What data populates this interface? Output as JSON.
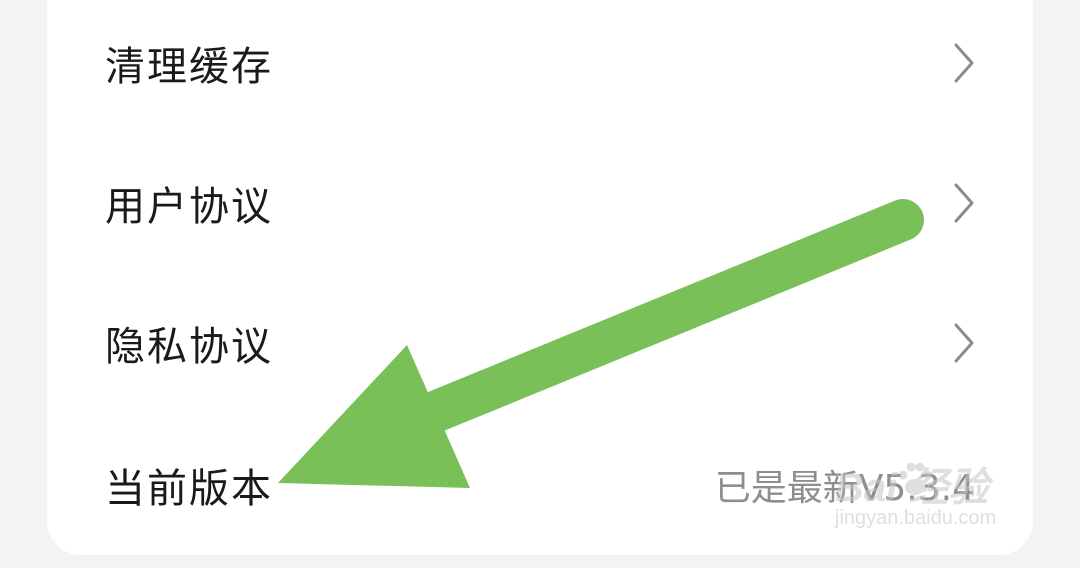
{
  "settings": {
    "items": [
      {
        "label": "清理缓存",
        "icon": "chevron-right-icon"
      },
      {
        "label": "用户协议",
        "icon": "chevron-right-icon"
      },
      {
        "label": "隐私协议",
        "icon": "chevron-right-icon"
      },
      {
        "label": "当前版本",
        "value": "已是最新V5.3.4"
      }
    ]
  },
  "annotation": {
    "icon": "green-arrow-icon",
    "color": "#79c058"
  },
  "watermark": {
    "logo": "Bai 经验",
    "url": "jingyan.baidu.com"
  }
}
